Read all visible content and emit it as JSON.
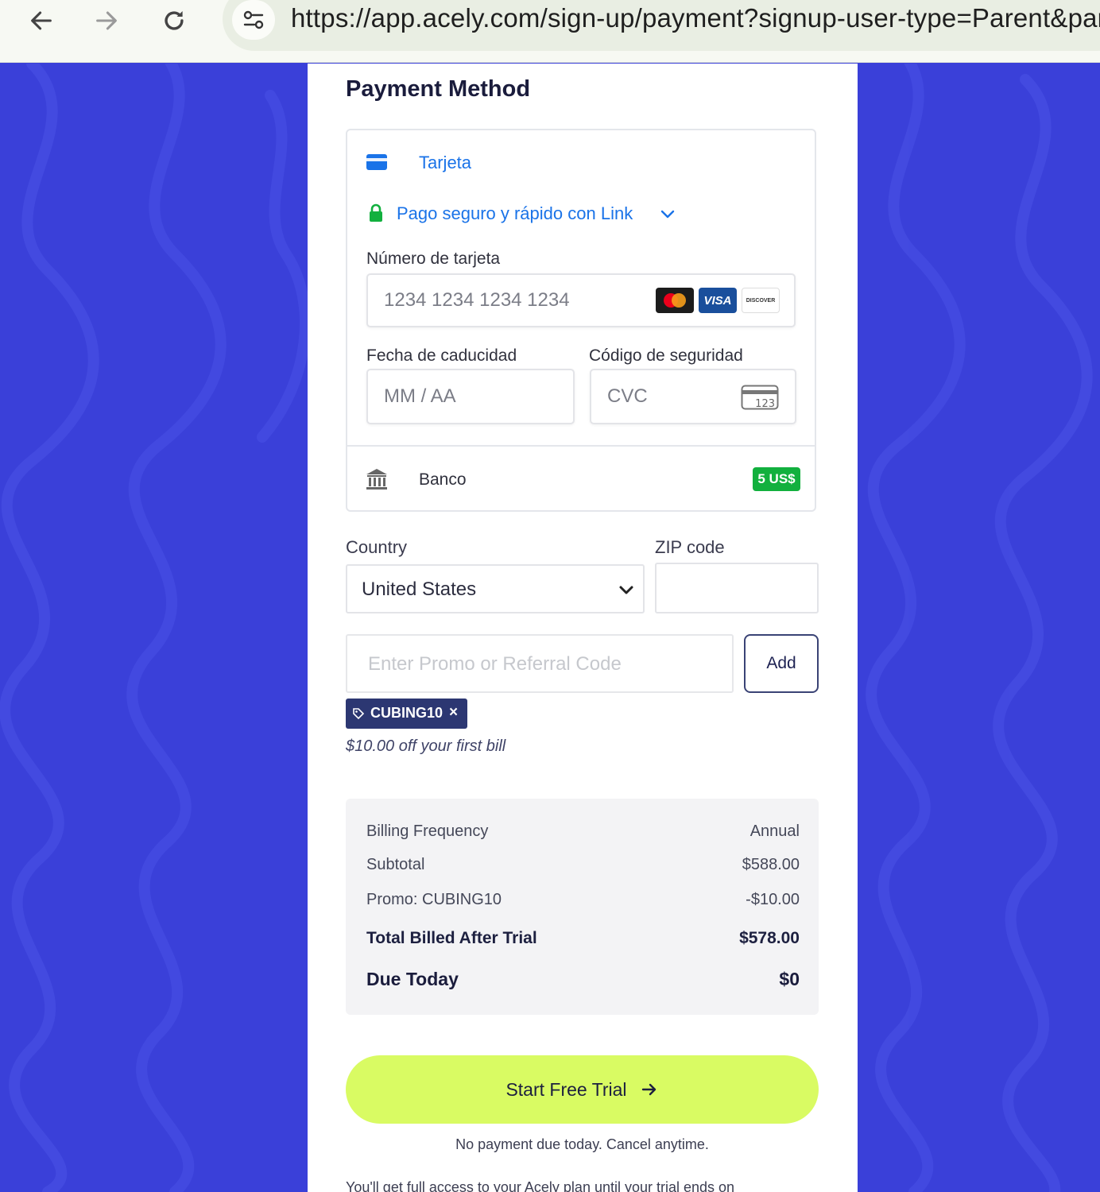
{
  "browser": {
    "url": "https://app.acely.com/sign-up/payment?signup-user-type=Parent&par"
  },
  "colors": {
    "background": "#3a40d9",
    "accent_button": "#d9fb63",
    "link_blue": "#1a73e8",
    "promo_chip": "#2c3772",
    "bank_badge": "#12b03e"
  },
  "payment": {
    "title": "Payment Method",
    "card_tab_label": "Tarjeta",
    "link_label": "Pago seguro y rápido con Link",
    "card_number_label": "Número de tarjeta",
    "card_number_placeholder": "1234 1234 1234 1234",
    "card_brands": [
      "mastercard",
      "VISA",
      "DISCOVER"
    ],
    "expiry_label": "Fecha de caducidad",
    "expiry_placeholder": "MM / AA",
    "security_label": "Código de seguridad",
    "cvc_placeholder": "CVC",
    "cvc_icon_text": "123",
    "bank_label": "Banco",
    "bank_badge": "5 US$"
  },
  "address": {
    "country_label": "Country",
    "country_value": "United States",
    "zip_label": "ZIP code",
    "zip_value": ""
  },
  "promo": {
    "placeholder": "Enter Promo or Referral Code",
    "add_label": "Add",
    "applied_code": "CUBING10",
    "remove_symbol": "×",
    "note": "$10.00 off your first bill"
  },
  "summary": {
    "rows": [
      {
        "label": "Billing Frequency",
        "value": "Annual"
      },
      {
        "label": "Subtotal",
        "value": "$588.00"
      },
      {
        "label": "Promo: CUBING10",
        "value": "-$10.00"
      },
      {
        "label": "Total Billed After Trial",
        "value": "$578.00"
      },
      {
        "label": "Due Today",
        "value": "$0"
      }
    ]
  },
  "cta": {
    "label": "Start Free Trial",
    "note": "No payment due today. Cancel anytime.",
    "fineprint": "You'll get full access to your Acely plan until your trial ends on"
  }
}
